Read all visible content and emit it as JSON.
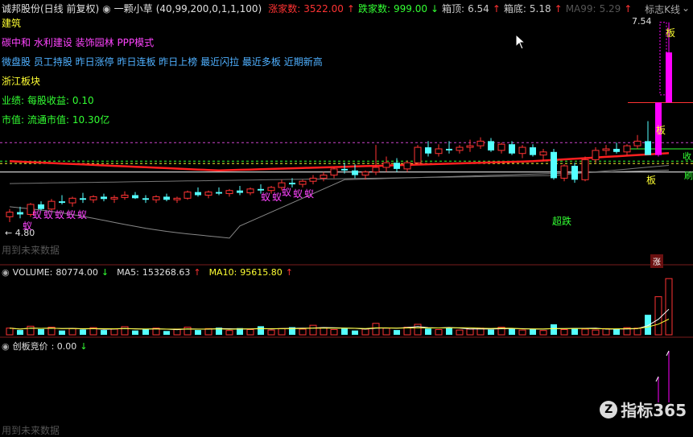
{
  "header": {
    "stock_title": "诚邦股份(日线 前复权)",
    "indicator_name": "一颗小草",
    "indicator_params": "(40,99,200,0,1,1,100)",
    "up_count_label": "涨家数:",
    "up_count_value": "3522.00",
    "down_count_label": "跌家数:",
    "down_count_value": "999.00",
    "box_top_label": "箱顶:",
    "box_top_value": "6.54",
    "box_bottom_label": "箱底:",
    "box_bottom_value": "5.18",
    "ma99_label": "MA99:",
    "ma99_value": "5.29",
    "k_line_toggle": "标志K线"
  },
  "info_lines": {
    "industry": "建筑",
    "concepts": "碳中和 水利建设 装饰园林 PPP模式",
    "tags": "微盘股 员工持股 昨日涨停 昨日连板 昨日上榜 最近闪拉 最近多板 近期新高",
    "region": "浙江板块",
    "eps_label": "业绩:",
    "eps_text": "每股收益: 0.10",
    "mcap_label": "市值:",
    "mcap_text": "流通市值: 10.30亿"
  },
  "main_chart": {
    "high_price_label": "7.54",
    "low_price_label": "4.80",
    "future_data_note": "用到未来数据",
    "ban_label_top": "板",
    "ban_label_mid": "板",
    "ban_label_bottom": "板",
    "chaodie_label": "超跌",
    "zhang_badge": "涨",
    "right_label_1": "收",
    "right_label_2": "刷",
    "ant_label": "蚁",
    "colors": {
      "up": "#ff3333",
      "down": "#54ffff",
      "magenta": "#ff00ff",
      "red_line": "#ff2020"
    }
  },
  "volume_panel": {
    "title": "VOLUME:",
    "volume_value": "80774.00",
    "ma5_label": "MA5:",
    "ma5_value": "153268.63",
    "ma10_label": "MA10:",
    "ma10_value": "95615.80"
  },
  "bid_panel": {
    "title": "创板竞价",
    "value": ": 0.00",
    "future_data_note": "用到未来数据"
  },
  "watermark": {
    "logo_char": "Z",
    "text": "指标365"
  },
  "candles": [
    [
      5.02,
      5.12,
      4.95,
      5.08
    ],
    [
      5.08,
      5.15,
      5.0,
      5.05
    ],
    [
      5.05,
      5.2,
      5.02,
      5.18
    ],
    [
      5.18,
      5.22,
      5.1,
      5.12
    ],
    [
      5.12,
      5.25,
      5.1,
      5.22
    ],
    [
      5.22,
      5.3,
      5.18,
      5.2
    ],
    [
      5.2,
      5.28,
      5.15,
      5.26
    ],
    [
      5.26,
      5.33,
      5.2,
      5.24
    ],
    [
      5.24,
      5.3,
      5.2,
      5.28
    ],
    [
      5.28,
      5.32,
      5.22,
      5.25
    ],
    [
      5.25,
      5.3,
      5.2,
      5.27
    ],
    [
      5.27,
      5.35,
      5.24,
      5.3
    ],
    [
      5.3,
      5.34,
      5.25,
      5.26
    ],
    [
      5.26,
      5.3,
      5.2,
      5.24
    ],
    [
      5.24,
      5.3,
      5.2,
      5.28
    ],
    [
      5.28,
      5.32,
      5.22,
      5.24
    ],
    [
      5.24,
      5.28,
      5.2,
      5.26
    ],
    [
      5.26,
      5.36,
      5.24,
      5.34
    ],
    [
      5.34,
      5.4,
      5.28,
      5.3
    ],
    [
      5.3,
      5.36,
      5.26,
      5.34
    ],
    [
      5.34,
      5.4,
      5.3,
      5.32
    ],
    [
      5.32,
      5.38,
      5.28,
      5.36
    ],
    [
      5.36,
      5.42,
      5.3,
      5.33
    ],
    [
      5.33,
      5.4,
      5.3,
      5.38
    ],
    [
      5.38,
      5.44,
      5.32,
      5.36
    ],
    [
      5.36,
      5.42,
      5.32,
      5.4
    ],
    [
      5.4,
      5.5,
      5.36,
      5.46
    ],
    [
      5.46,
      5.52,
      5.4,
      5.44
    ],
    [
      5.44,
      5.5,
      5.4,
      5.48
    ],
    [
      5.48,
      5.56,
      5.44,
      5.52
    ],
    [
      5.52,
      5.6,
      5.48,
      5.56
    ],
    [
      5.56,
      5.66,
      5.52,
      5.64
    ],
    [
      5.64,
      5.72,
      5.58,
      5.62
    ],
    [
      5.62,
      5.7,
      5.52,
      5.56
    ],
    [
      5.56,
      5.62,
      5.5,
      5.6
    ],
    [
      5.6,
      5.95,
      5.56,
      5.66
    ],
    [
      5.66,
      5.8,
      5.6,
      5.72
    ],
    [
      5.72,
      5.78,
      5.6,
      5.64
    ],
    [
      5.64,
      5.75,
      5.6,
      5.72
    ],
    [
      5.72,
      5.95,
      5.7,
      5.92
    ],
    [
      5.92,
      6.0,
      5.8,
      5.84
    ],
    [
      5.84,
      5.96,
      5.8,
      5.9
    ],
    [
      5.9,
      6.0,
      5.84,
      5.88
    ],
    [
      5.88,
      5.95,
      5.84,
      5.92
    ],
    [
      5.92,
      6.02,
      5.86,
      5.94
    ],
    [
      5.94,
      6.05,
      5.9,
      6.0
    ],
    [
      6.0,
      6.04,
      5.86,
      5.88
    ],
    [
      5.88,
      5.98,
      5.84,
      5.96
    ],
    [
      5.96,
      6.0,
      5.82,
      5.84
    ],
    [
      5.84,
      5.95,
      5.78,
      5.92
    ],
    [
      5.92,
      5.96,
      5.8,
      5.82
    ],
    [
      5.82,
      5.9,
      5.74,
      5.86
    ],
    [
      5.86,
      5.9,
      5.5,
      5.52
    ],
    [
      5.52,
      5.7,
      5.48,
      5.68
    ],
    [
      5.68,
      5.72,
      5.46,
      5.5
    ],
    [
      5.5,
      5.8,
      5.48,
      5.76
    ],
    [
      5.76,
      5.92,
      5.72,
      5.88
    ],
    [
      5.88,
      5.95,
      5.82,
      5.9
    ],
    [
      5.9,
      5.98,
      5.84,
      5.86
    ],
    [
      5.86,
      5.96,
      5.82,
      5.94
    ],
    [
      5.94,
      6.08,
      5.9,
      6.0
    ],
    [
      6.0,
      6.26,
      5.9,
      5.82
    ],
    [
      5.82,
      6.5,
      5.8,
      6.5
    ],
    [
      6.5,
      7.54,
      6.5,
      7.15
    ]
  ],
  "volumes": [
    14,
    10,
    18,
    12,
    16,
    9,
    13,
    11,
    15,
    10,
    12,
    17,
    9,
    11,
    14,
    8,
    12,
    16,
    10,
    13,
    15,
    9,
    14,
    11,
    18,
    10,
    13,
    16,
    12,
    20,
    15,
    11,
    13,
    9,
    12,
    24,
    14,
    10,
    16,
    22,
    13,
    11,
    15,
    10,
    12,
    14,
    11,
    16,
    13,
    10,
    12,
    9,
    22,
    11,
    14,
    12,
    10,
    13,
    12,
    15,
    14,
    42,
    80,
    118
  ],
  "bid_spikes": [
    0,
    0,
    0,
    0,
    0,
    0,
    0,
    0,
    0,
    0,
    0,
    0,
    0,
    0,
    0,
    0,
    0,
    0,
    0,
    0,
    0,
    0,
    0,
    0,
    0,
    0,
    0,
    0,
    0,
    0,
    0,
    0,
    0,
    0,
    0,
    0,
    0,
    0,
    0,
    0,
    0,
    0,
    0,
    0,
    0,
    0,
    0,
    0,
    0,
    0,
    0,
    0,
    0,
    0,
    0,
    0,
    0,
    0,
    0,
    0,
    0,
    0,
    30,
    60
  ]
}
